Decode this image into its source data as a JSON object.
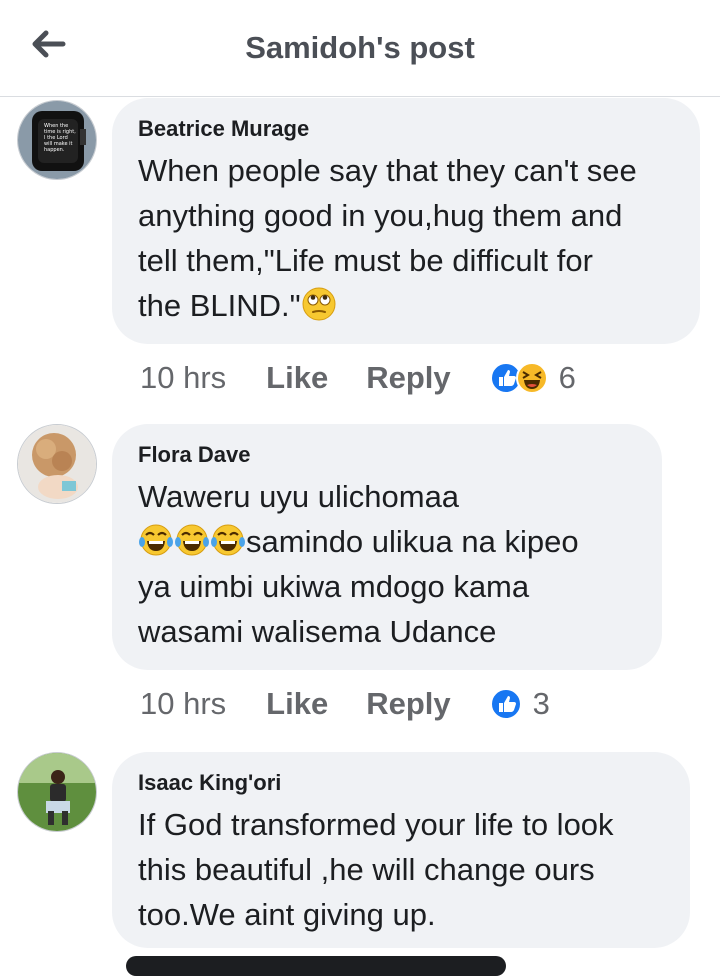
{
  "header": {
    "title": "Samidoh's post",
    "back_icon": "arrow-left-icon"
  },
  "comments": [
    {
      "author": "Beatrice Murage",
      "lines": [
        "When people say that they can't see",
        "anything good in you,hug them and",
        "tell them,\"Life must be difficult for",
        "the BLIND.\""
      ],
      "trailing_emoji": "eye-roll-emoji-icon",
      "time": "10 hrs",
      "like_label": "Like",
      "reply_label": "Reply",
      "reactions": [
        "like-reaction-icon",
        "haha-reaction-icon"
      ],
      "reaction_count": "6"
    },
    {
      "author": "Flora Dave",
      "lines": [
        "Waweru uyu ulichomaa",
        "samindo ulikua na kipeo",
        "ya uimbi ukiwa mdogo  kama",
        "wasami walisema Udance"
      ],
      "leading_emojis": [
        "tears-of-joy-emoji-icon",
        "tears-of-joy-emoji-icon",
        "tears-of-joy-emoji-icon"
      ],
      "time": "10 hrs",
      "like_label": "Like",
      "reply_label": "Reply",
      "reactions": [
        "like-reaction-icon"
      ],
      "reaction_count": "3"
    },
    {
      "author": "Isaac King'ori",
      "lines": [
        "If God transformed your life to look",
        "this beautiful ,he will change ours",
        "too.We aint giving up."
      ]
    }
  ],
  "colors": {
    "bubble": "#f0f2f5",
    "meta_text": "#65676b",
    "like_blue": "#1877f2",
    "haha_yellow": "#f7b928"
  }
}
